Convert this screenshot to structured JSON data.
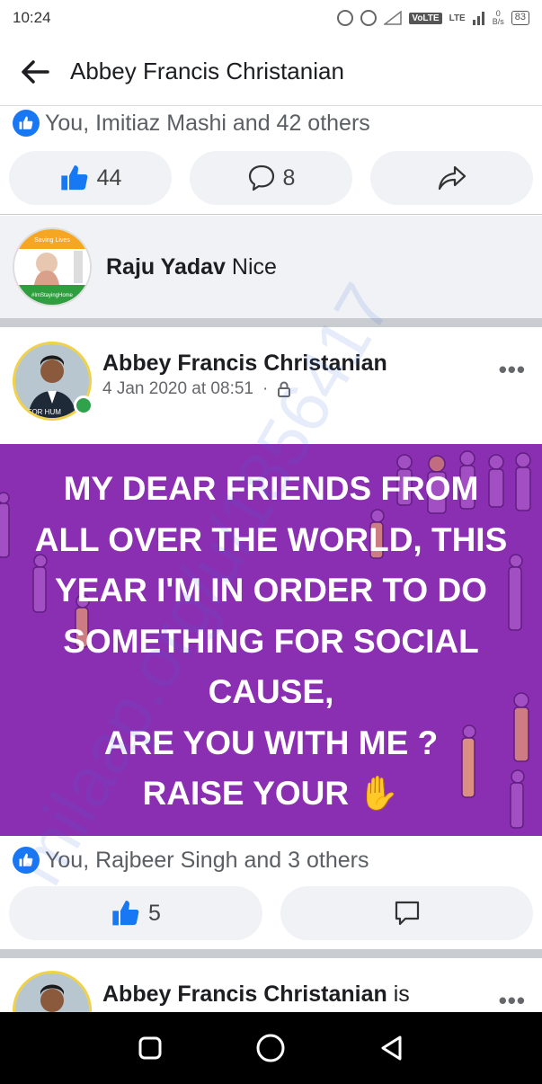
{
  "status_bar": {
    "time": "10:24",
    "volte": "VoLTE",
    "lte": "LTE",
    "net_speed_value": "0",
    "net_speed_unit": "B/s",
    "battery": "83"
  },
  "header": {
    "title": "Abbey Francis Christanian"
  },
  "top_post": {
    "reactions_text": "You, Imitiaz Mashi and 42 others",
    "like_count": "44",
    "comment_count": "8"
  },
  "comment": {
    "author": "Raju Yadav",
    "text": "Nice",
    "avatar_top_text": "Saving Lives",
    "avatar_bottom_text": "#ImStayingHome"
  },
  "post": {
    "author": "Abbey Francis Christanian",
    "timestamp": "4 Jan 2020 at 08:51",
    "separator": "·",
    "more": "•••",
    "avatar_caption": "E FOR HUM",
    "banner_text": "MY DEAR FRIENDS FROM\nALL OVER THE WORLD, THIS\nYEAR I'M IN ORDER TO DO\nSOMETHING FOR SOCIAL\nCAUSE,\nARE YOU WITH ME ?\nRAISE YOUR ",
    "banner_emoji": "✋",
    "reactions_text": "You, Rajbeer Singh and 3 others",
    "like_count": "5"
  },
  "next_post": {
    "author": "Abbey Francis Christanian",
    "author_suffix": "is",
    "more": "•••"
  },
  "watermark": {
    "text": "milaap.org/u/1856417"
  },
  "colors": {
    "facebook_blue": "#1877f2",
    "banner_purple": "#8a2fb2",
    "online_green": "#31a24c"
  }
}
